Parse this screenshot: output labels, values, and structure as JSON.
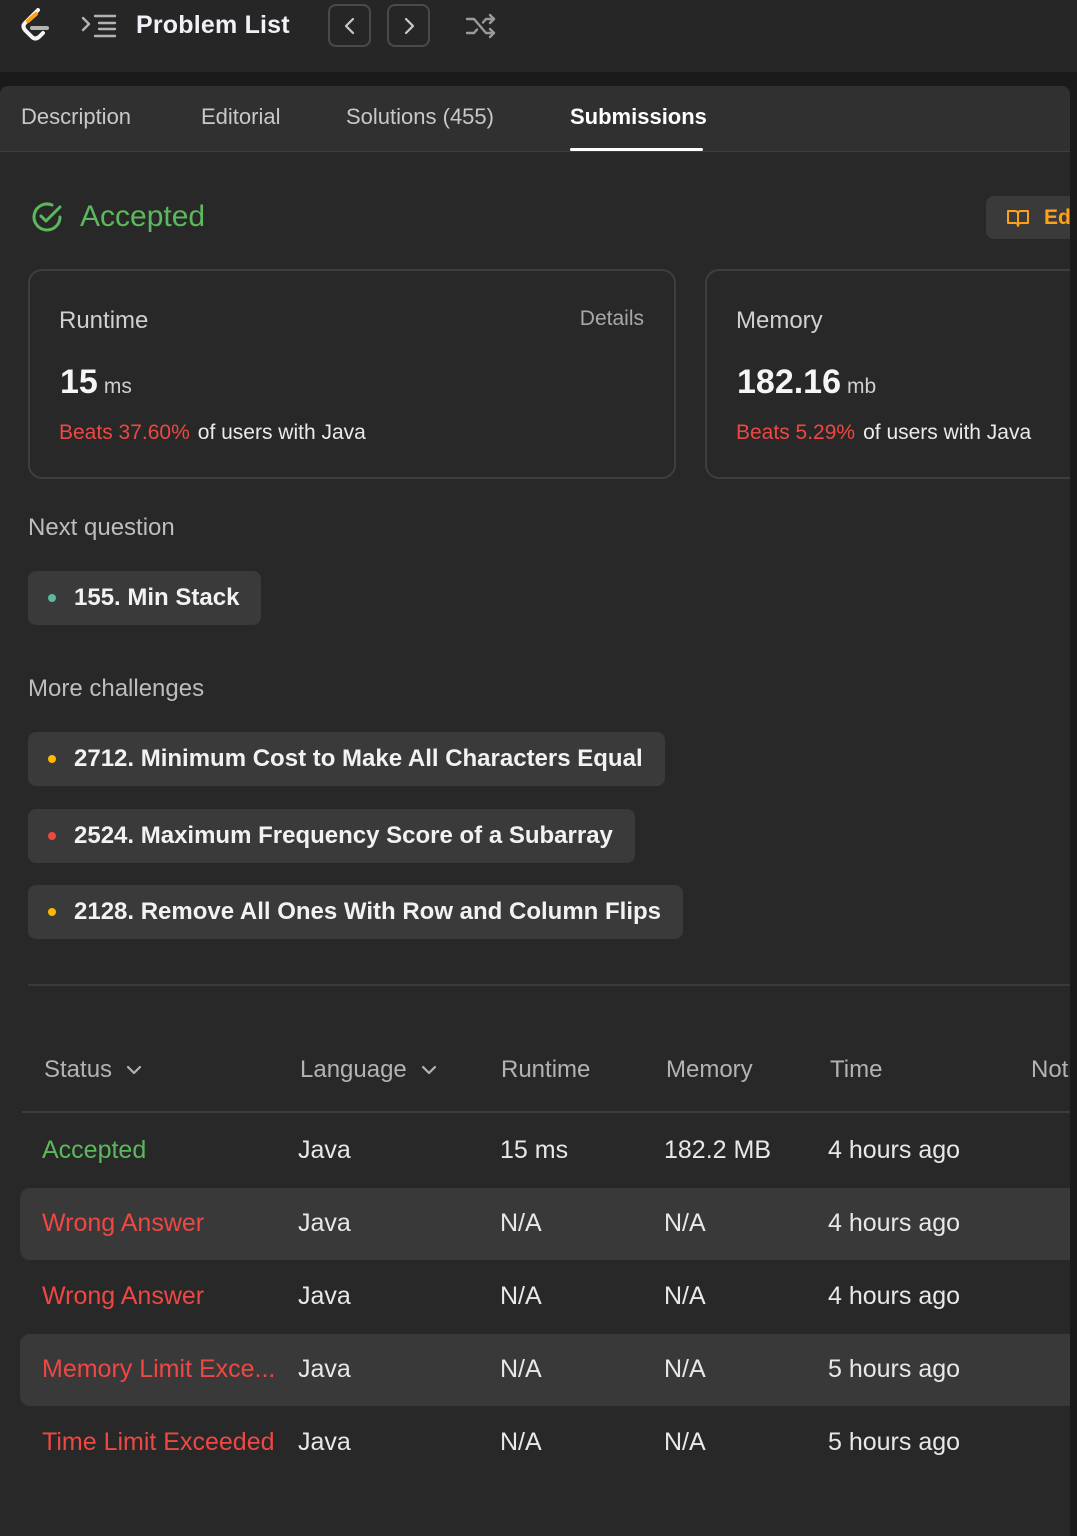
{
  "topbar": {
    "title": "Problem List",
    "icons": [
      "leetcode-logo",
      "list-icon",
      "chevron-left-icon",
      "chevron-right-icon",
      "shuffle-icon"
    ]
  },
  "tabs": [
    {
      "label": "Description"
    },
    {
      "label": "Editorial"
    },
    {
      "label": "Solutions (455)"
    },
    {
      "label": "Submissions"
    }
  ],
  "result": {
    "status": "Accepted",
    "editorial_label": "Ed"
  },
  "runtime_card": {
    "label": "Runtime",
    "details_label": "Details",
    "value": "15",
    "unit": "ms",
    "beats": "Beats 37.60%",
    "beats_suffix": "of users with Java"
  },
  "memory_card": {
    "label": "Memory",
    "value": "182.16",
    "unit": "mb",
    "beats": "Beats 5.29%",
    "beats_suffix": "of users with Java"
  },
  "next_question": {
    "label": "Next question",
    "item": "155. Min Stack"
  },
  "more_challenges": {
    "label": "More challenges",
    "items": [
      {
        "title": "2712. Minimum Cost to Make All Characters Equal"
      },
      {
        "title": "2524. Maximum Frequency Score of a Subarray"
      },
      {
        "title": "2128. Remove All Ones With Row and Column Flips"
      }
    ]
  },
  "colors": {
    "easy": "#5cb8a0",
    "medium": "#ffb800",
    "hard": "#ef4743",
    "accepted": "#5cb85c",
    "error": "#ef4743"
  },
  "table": {
    "headers": {
      "status": "Status",
      "language": "Language",
      "runtime": "Runtime",
      "memory": "Memory",
      "time": "Time",
      "notes": "Not"
    },
    "rows": [
      {
        "status": "Accepted",
        "language": "Java",
        "runtime": "15 ms",
        "memory": "182.2 MB",
        "time": "4 hours ago"
      },
      {
        "status": "Wrong Answer",
        "language": "Java",
        "runtime": "N/A",
        "memory": "N/A",
        "time": "4 hours ago"
      },
      {
        "status": "Wrong Answer",
        "language": "Java",
        "runtime": "N/A",
        "memory": "N/A",
        "time": "4 hours ago"
      },
      {
        "status": "Memory Limit Exce...",
        "language": "Java",
        "runtime": "N/A",
        "memory": "N/A",
        "time": "5 hours ago"
      },
      {
        "status": "Time Limit Exceeded",
        "language": "Java",
        "runtime": "N/A",
        "memory": "N/A",
        "time": "5 hours ago"
      }
    ]
  }
}
